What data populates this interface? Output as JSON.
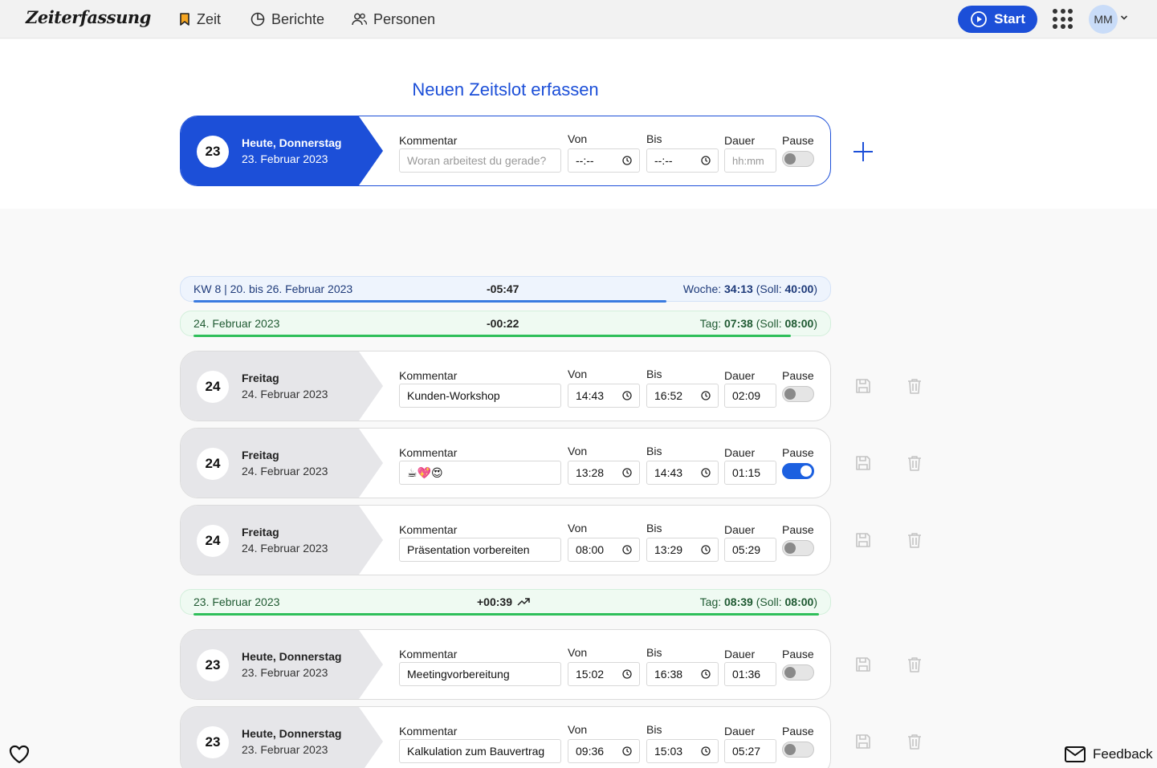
{
  "app": {
    "title": "Zeiterfassung"
  },
  "nav": {
    "zeit": "Zeit",
    "berichte": "Berichte",
    "personen": "Personen"
  },
  "header": {
    "start_label": "Start",
    "avatar_initials": "MM"
  },
  "new_entry": {
    "heading": "Neuen Zeitslot erfassen",
    "day_number": "23",
    "day_name": "Heute, Donnerstag",
    "date": "23. Februar 2023",
    "comment_label": "Kommentar",
    "comment_placeholder": "Woran arbeitest du gerade?",
    "from_label": "Von",
    "from_placeholder": "--:--",
    "to_label": "Bis",
    "to_placeholder": "--:--",
    "duration_label": "Dauer",
    "duration_placeholder": "hh:mm",
    "pause_label": "Pause",
    "pause_on": false
  },
  "week_summary": {
    "label": "KW 8 | 20. bis 26. Februar 2023",
    "delta": "-05:47",
    "total_prefix": "Woche:",
    "total": "34:13",
    "target_prefix": "(Soll:",
    "target": "40:00",
    "target_suffix": ")",
    "progress": 0.855
  },
  "day_summaries": [
    {
      "label": "24. Februar 2023",
      "delta": "-00:22",
      "total_prefix": "Tag:",
      "total": "07:38",
      "target_prefix": "(Soll:",
      "target": "08:00",
      "target_suffix": ")",
      "progress": 0.955,
      "trend_icon": ""
    },
    {
      "label": "23. Februar 2023",
      "delta": "+00:39",
      "total_prefix": "Tag:",
      "total": "08:39",
      "target_prefix": "(Soll:",
      "target": "08:00",
      "target_suffix": ")",
      "progress": 1.0,
      "trend_icon": "trending-up-icon"
    }
  ],
  "field_labels": {
    "comment": "Kommentar",
    "from": "Von",
    "to": "Bis",
    "duration": "Dauer",
    "pause": "Pause"
  },
  "entries": [
    {
      "day_number": "24",
      "day_name": "Freitag",
      "date": "24. Februar 2023",
      "comment": "Kunden-Workshop",
      "from": "14:43",
      "to": "16:52",
      "duration": "02:09",
      "pause_on": false
    },
    {
      "day_number": "24",
      "day_name": "Freitag",
      "date": "24. Februar 2023",
      "comment": "☕💖😍",
      "from": "13:28",
      "to": "14:43",
      "duration": "01:15",
      "pause_on": true
    },
    {
      "day_number": "24",
      "day_name": "Freitag",
      "date": "24. Februar 2023",
      "comment": "Präsentation vorbereiten",
      "from": "08:00",
      "to": "13:29",
      "duration": "05:29",
      "pause_on": false
    },
    {
      "day_number": "23",
      "day_name": "Heute, Donnerstag",
      "date": "23. Februar 2023",
      "comment": "Meetingvorbereitung",
      "from": "15:02",
      "to": "16:38",
      "duration": "01:36",
      "pause_on": false
    },
    {
      "day_number": "23",
      "day_name": "Heute, Donnerstag",
      "date": "23. Februar 2023",
      "comment": "Kalkulation zum Bauvertrag",
      "from": "09:36",
      "to": "15:03",
      "duration": "05:27",
      "pause_on": false
    }
  ],
  "footer": {
    "feedback_label": "Feedback"
  },
  "colors": {
    "primary": "#1c4fd8",
    "week_bar": "#3b7be0",
    "day_bar": "#2fbf5a",
    "date_tab": "#e6e6e9"
  }
}
